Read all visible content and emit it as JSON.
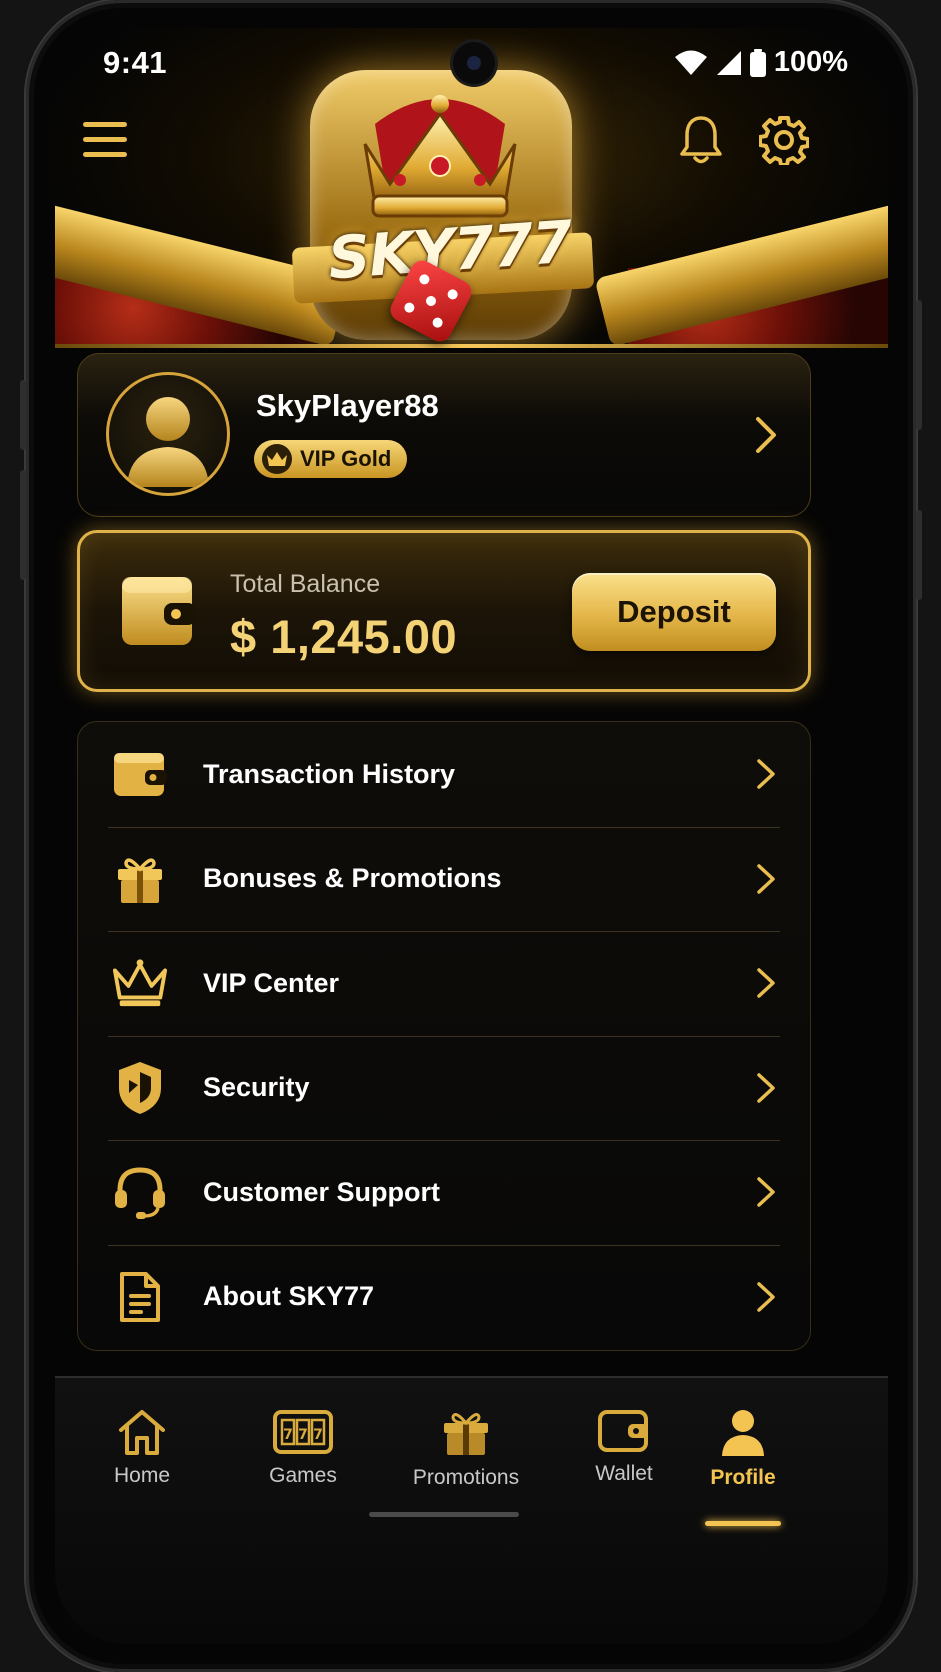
{
  "status_bar": {
    "time": "9:41",
    "battery": "100%"
  },
  "brand": {
    "logo_text": "SKY777"
  },
  "profile": {
    "username": "SkyPlayer88",
    "vip_level": "VIP Gold"
  },
  "balance": {
    "label": "Total Balance",
    "value": "$ 1,245.00",
    "deposit_label": "Deposit"
  },
  "menu": [
    {
      "label": "Transaction History",
      "icon": "wallet-icon"
    },
    {
      "label": "Bonuses & Promotions",
      "icon": "gift-icon"
    },
    {
      "label": "VIP Center",
      "icon": "crown-icon"
    },
    {
      "label": "Security",
      "icon": "shield-icon"
    },
    {
      "label": "Customer Support",
      "icon": "headset-icon"
    },
    {
      "label": "About SKY77",
      "icon": "document-icon"
    }
  ],
  "nav": [
    {
      "label": "Home",
      "icon": "home-icon",
      "active": false
    },
    {
      "label": "Games",
      "icon": "slot-machine-icon",
      "active": false
    },
    {
      "label": "Promotions",
      "icon": "gift-icon",
      "active": false
    },
    {
      "label": "Wallet",
      "icon": "wallet-icon",
      "active": false
    },
    {
      "label": "Profile",
      "icon": "user-icon",
      "active": true
    }
  ],
  "colors": {
    "gold": "#f3c451",
    "gold_dark": "#c18e20",
    "background": "#050505",
    "text": "#ffffff"
  }
}
